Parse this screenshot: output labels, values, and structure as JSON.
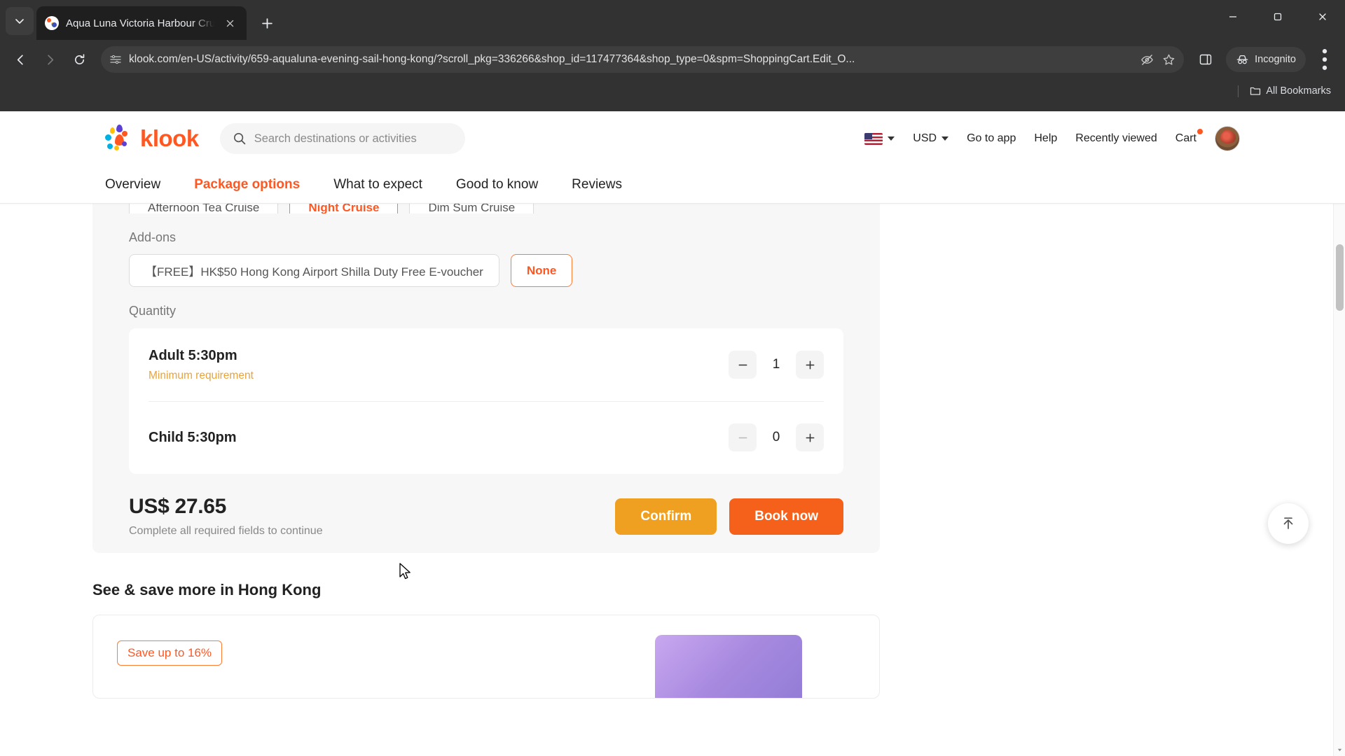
{
  "browser": {
    "tab": {
      "title": "Aqua Luna Victoria Harbour Cru",
      "favicon_name": "klook-favicon"
    },
    "new_tab_label": "+",
    "url": "klook.com/en-US/activity/659-aqualuna-evening-sail-hong-kong/?scroll_pkg=336266&shop_id=117477364&shop_type=0&spm=ShoppingCart.Edit_O...",
    "incognito_label": "Incognito",
    "bookmarks": {
      "all_bookmarks_label": "All Bookmarks"
    },
    "icons": {
      "tab_search": "tab-search-icon",
      "back": "back-arrow-icon",
      "forward": "forward-arrow-icon",
      "reload": "reload-icon",
      "site_info": "site-settings-icon",
      "tracking": "eye-crossed-icon",
      "bookmark": "star-icon",
      "side_panel": "side-panel-icon",
      "incognito": "incognito-icon",
      "menu": "three-dots-menu-icon",
      "minimize": "minimize-icon",
      "maximize": "maximize-icon",
      "close": "close-icon"
    }
  },
  "site": {
    "logo_text": "klook",
    "search": {
      "placeholder": "Search destinations or activities"
    },
    "header_links": [
      {
        "label": "Go to app"
      },
      {
        "label": "Help"
      },
      {
        "label": "Recently viewed"
      }
    ],
    "currency": "USD",
    "language_flag": "us-flag-icon",
    "cart_label": "Cart",
    "cart_has_badge": true,
    "nav_tabs": [
      {
        "label": "Overview",
        "active": false
      },
      {
        "label": "Package options",
        "active": true
      },
      {
        "label": "What to expect",
        "active": false
      },
      {
        "label": "Good to know",
        "active": false
      },
      {
        "label": "Reviews",
        "active": false
      }
    ]
  },
  "package": {
    "cruise_options": [
      {
        "label": "Afternoon Tea Cruise",
        "selected": false
      },
      {
        "label": "Night Cruise",
        "selected": true
      },
      {
        "label": "Dim Sum Cruise",
        "selected": false
      }
    ],
    "addons_label": "Add-ons",
    "addons": [
      {
        "label": "【FREE】HK$50 Hong Kong Airport Shilla Duty Free E-voucher",
        "selected": false
      },
      {
        "label": "None",
        "selected": true
      }
    ],
    "quantity_label": "Quantity",
    "quantity_rows": [
      {
        "name": "Adult 5:30pm",
        "note": "Minimum requirement",
        "value": "1",
        "minus_disabled": false
      },
      {
        "name": "Child 5:30pm",
        "note": "",
        "value": "0",
        "minus_disabled": true
      }
    ],
    "total_price": "US$ 27.65",
    "price_note": "Complete all required fields to continue",
    "confirm_label": "Confirm",
    "book_label": "Book now"
  },
  "recommendations": {
    "section_title": "See & save more in Hong Kong",
    "save_badge": "Save up to 16%"
  },
  "colors": {
    "brand_orange": "#ff5722",
    "confirm_amber": "#f0a020",
    "book_orange": "#f5601a",
    "warning_amber": "#e8a33d"
  }
}
